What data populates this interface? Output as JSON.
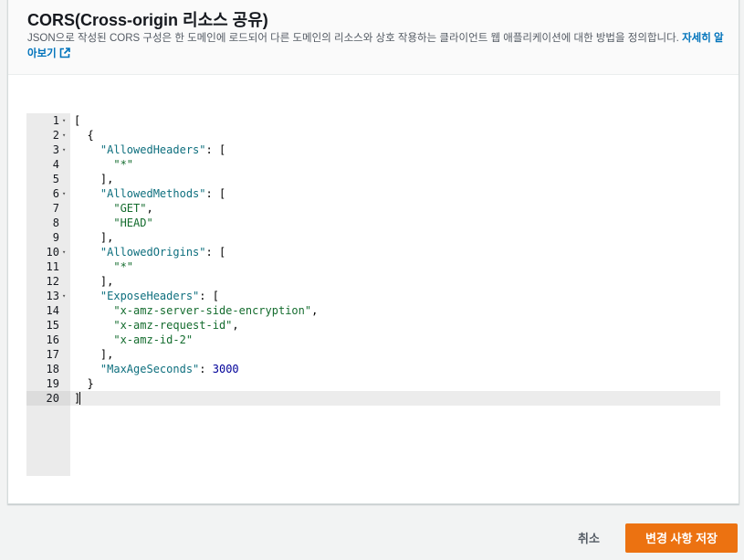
{
  "section": {
    "title": "CORS(Cross-origin 리소스 공유)",
    "description": "JSON으로 작성된 CORS 구성은 한 도메인에 로드되어 다른 도메인의 리소스와 상호 작용하는 클라이언트 웹 애플리케이션에 대한 방법을 정의합니다.",
    "learn_more": "자세히 알아보기",
    "learn_more_icon": "external-link-icon"
  },
  "editor": {
    "active_line": 20,
    "lines": [
      {
        "n": "1",
        "fold": true,
        "code": "["
      },
      {
        "n": "2",
        "fold": true,
        "code": "  {"
      },
      {
        "n": "3",
        "fold": true,
        "code": "    \"AllowedHeaders\": ["
      },
      {
        "n": "4",
        "fold": false,
        "code": "      \"*\""
      },
      {
        "n": "5",
        "fold": false,
        "code": "    ],"
      },
      {
        "n": "6",
        "fold": true,
        "code": "    \"AllowedMethods\": ["
      },
      {
        "n": "7",
        "fold": false,
        "code": "      \"GET\","
      },
      {
        "n": "8",
        "fold": false,
        "code": "      \"HEAD\""
      },
      {
        "n": "9",
        "fold": false,
        "code": "    ],"
      },
      {
        "n": "10",
        "fold": true,
        "code": "    \"AllowedOrigins\": ["
      },
      {
        "n": "11",
        "fold": false,
        "code": "      \"*\""
      },
      {
        "n": "12",
        "fold": false,
        "code": "    ],"
      },
      {
        "n": "13",
        "fold": true,
        "code": "    \"ExposeHeaders\": ["
      },
      {
        "n": "14",
        "fold": false,
        "code": "      \"x-amz-server-side-encryption\","
      },
      {
        "n": "15",
        "fold": false,
        "code": "      \"x-amz-request-id\","
      },
      {
        "n": "16",
        "fold": false,
        "code": "      \"x-amz-id-2\""
      },
      {
        "n": "17",
        "fold": false,
        "code": "    ],"
      },
      {
        "n": "18",
        "fold": false,
        "code": "    \"MaxAgeSeconds\": 3000"
      },
      {
        "n": "19",
        "fold": false,
        "code": "  }"
      },
      {
        "n": "20",
        "fold": false,
        "code": "]"
      }
    ]
  },
  "footer": {
    "cancel_label": "취소",
    "save_label": "변경 사항 저장"
  },
  "colors": {
    "accent": "#ec7211",
    "link": "#0073bb",
    "json_key": "#0e6f7e",
    "json_string": "#146c2e",
    "json_number": "#000099"
  }
}
